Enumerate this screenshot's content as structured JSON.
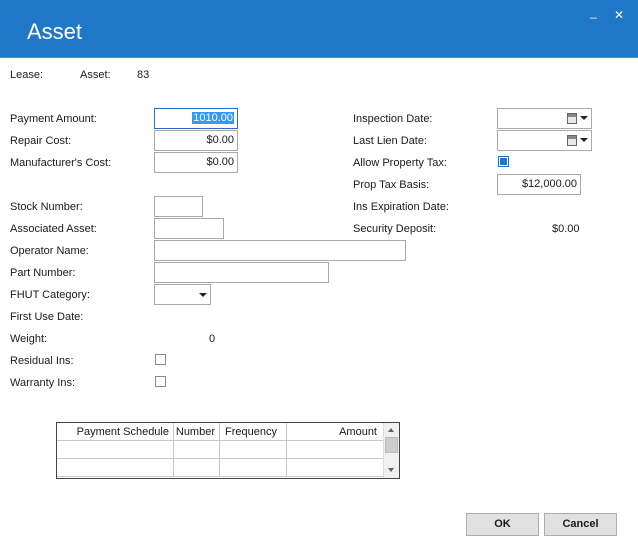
{
  "window": {
    "title": "Asset",
    "minimize": "_",
    "close": "✕"
  },
  "header": {
    "lease_label": "Lease:",
    "asset_label": "Asset:",
    "asset_value": "83"
  },
  "left": {
    "payment_amount": {
      "label": "Payment Amount:",
      "value": "1010.00"
    },
    "repair_cost": {
      "label": "Repair Cost:",
      "value": "$0.00"
    },
    "manufacturer_cost": {
      "label": "Manufacturer's Cost:",
      "value": "$0.00"
    },
    "stock_number": {
      "label": "Stock Number:",
      "value": ""
    },
    "associated_asset": {
      "label": "Associated Asset:",
      "value": ""
    },
    "operator_name": {
      "label": "Operator Name:",
      "value": ""
    },
    "part_number": {
      "label": "Part Number:",
      "value": ""
    },
    "fhut_category": {
      "label": "FHUT Category:",
      "value": ""
    },
    "first_use_date": {
      "label": "First Use Date:"
    },
    "weight": {
      "label": "Weight:",
      "value": "0"
    },
    "residual_ins": {
      "label": "Residual Ins:",
      "checked": false
    },
    "warranty_ins": {
      "label": "Warranty Ins:",
      "checked": false
    }
  },
  "right": {
    "inspection_date": {
      "label": "Inspection Date:",
      "value": ""
    },
    "last_lien_date": {
      "label": "Last Lien Date:",
      "value": ""
    },
    "allow_property_tax": {
      "label": "Allow Property Tax:",
      "checked": true
    },
    "prop_tax_basis": {
      "label": "Prop Tax Basis:",
      "value": "$12,000.00"
    },
    "ins_expiration_date": {
      "label": "Ins Expiration Date:"
    },
    "security_deposit": {
      "label": "Security Deposit:",
      "value": "$0.00"
    }
  },
  "schedule_grid": {
    "columns": [
      "Payment Schedule",
      "Number",
      "Frequency",
      "Amount"
    ]
  },
  "buttons": {
    "ok": "OK",
    "cancel": "Cancel"
  },
  "colors": {
    "title_bar": "#1e77c7",
    "checkbox_on": "#1e77c7"
  }
}
